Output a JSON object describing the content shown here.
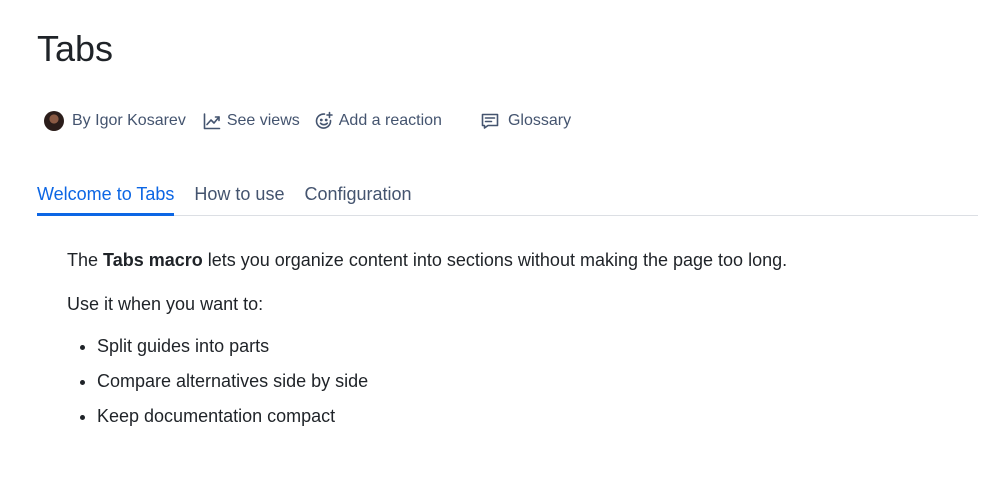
{
  "page": {
    "title": "Tabs"
  },
  "byline": {
    "author": "By Igor Kosarev",
    "views": "See views",
    "reaction": "Add a reaction",
    "glossary": "Glossary"
  },
  "tabs": [
    {
      "label": "Welcome to Tabs",
      "active": true
    },
    {
      "label": "How to use",
      "active": false
    },
    {
      "label": "Configuration",
      "active": false
    }
  ],
  "content": {
    "intro_prefix": "The ",
    "intro_bold": "Tabs macro",
    "intro_suffix": " lets you organize content into sections without making the page too long.",
    "use_when": "Use it when you want to:",
    "bullets": [
      "Split guides into parts",
      "Compare alternatives side by side",
      "Keep documentation compact"
    ]
  },
  "colors": {
    "accent": "#0c66e4",
    "text": "#1f2328",
    "muted": "#44546f",
    "divider": "#dcdfe4"
  },
  "icons": {
    "author": "avatar",
    "views": "trend-line-icon",
    "reaction": "add-emoji-icon",
    "glossary": "glossary-icon"
  }
}
